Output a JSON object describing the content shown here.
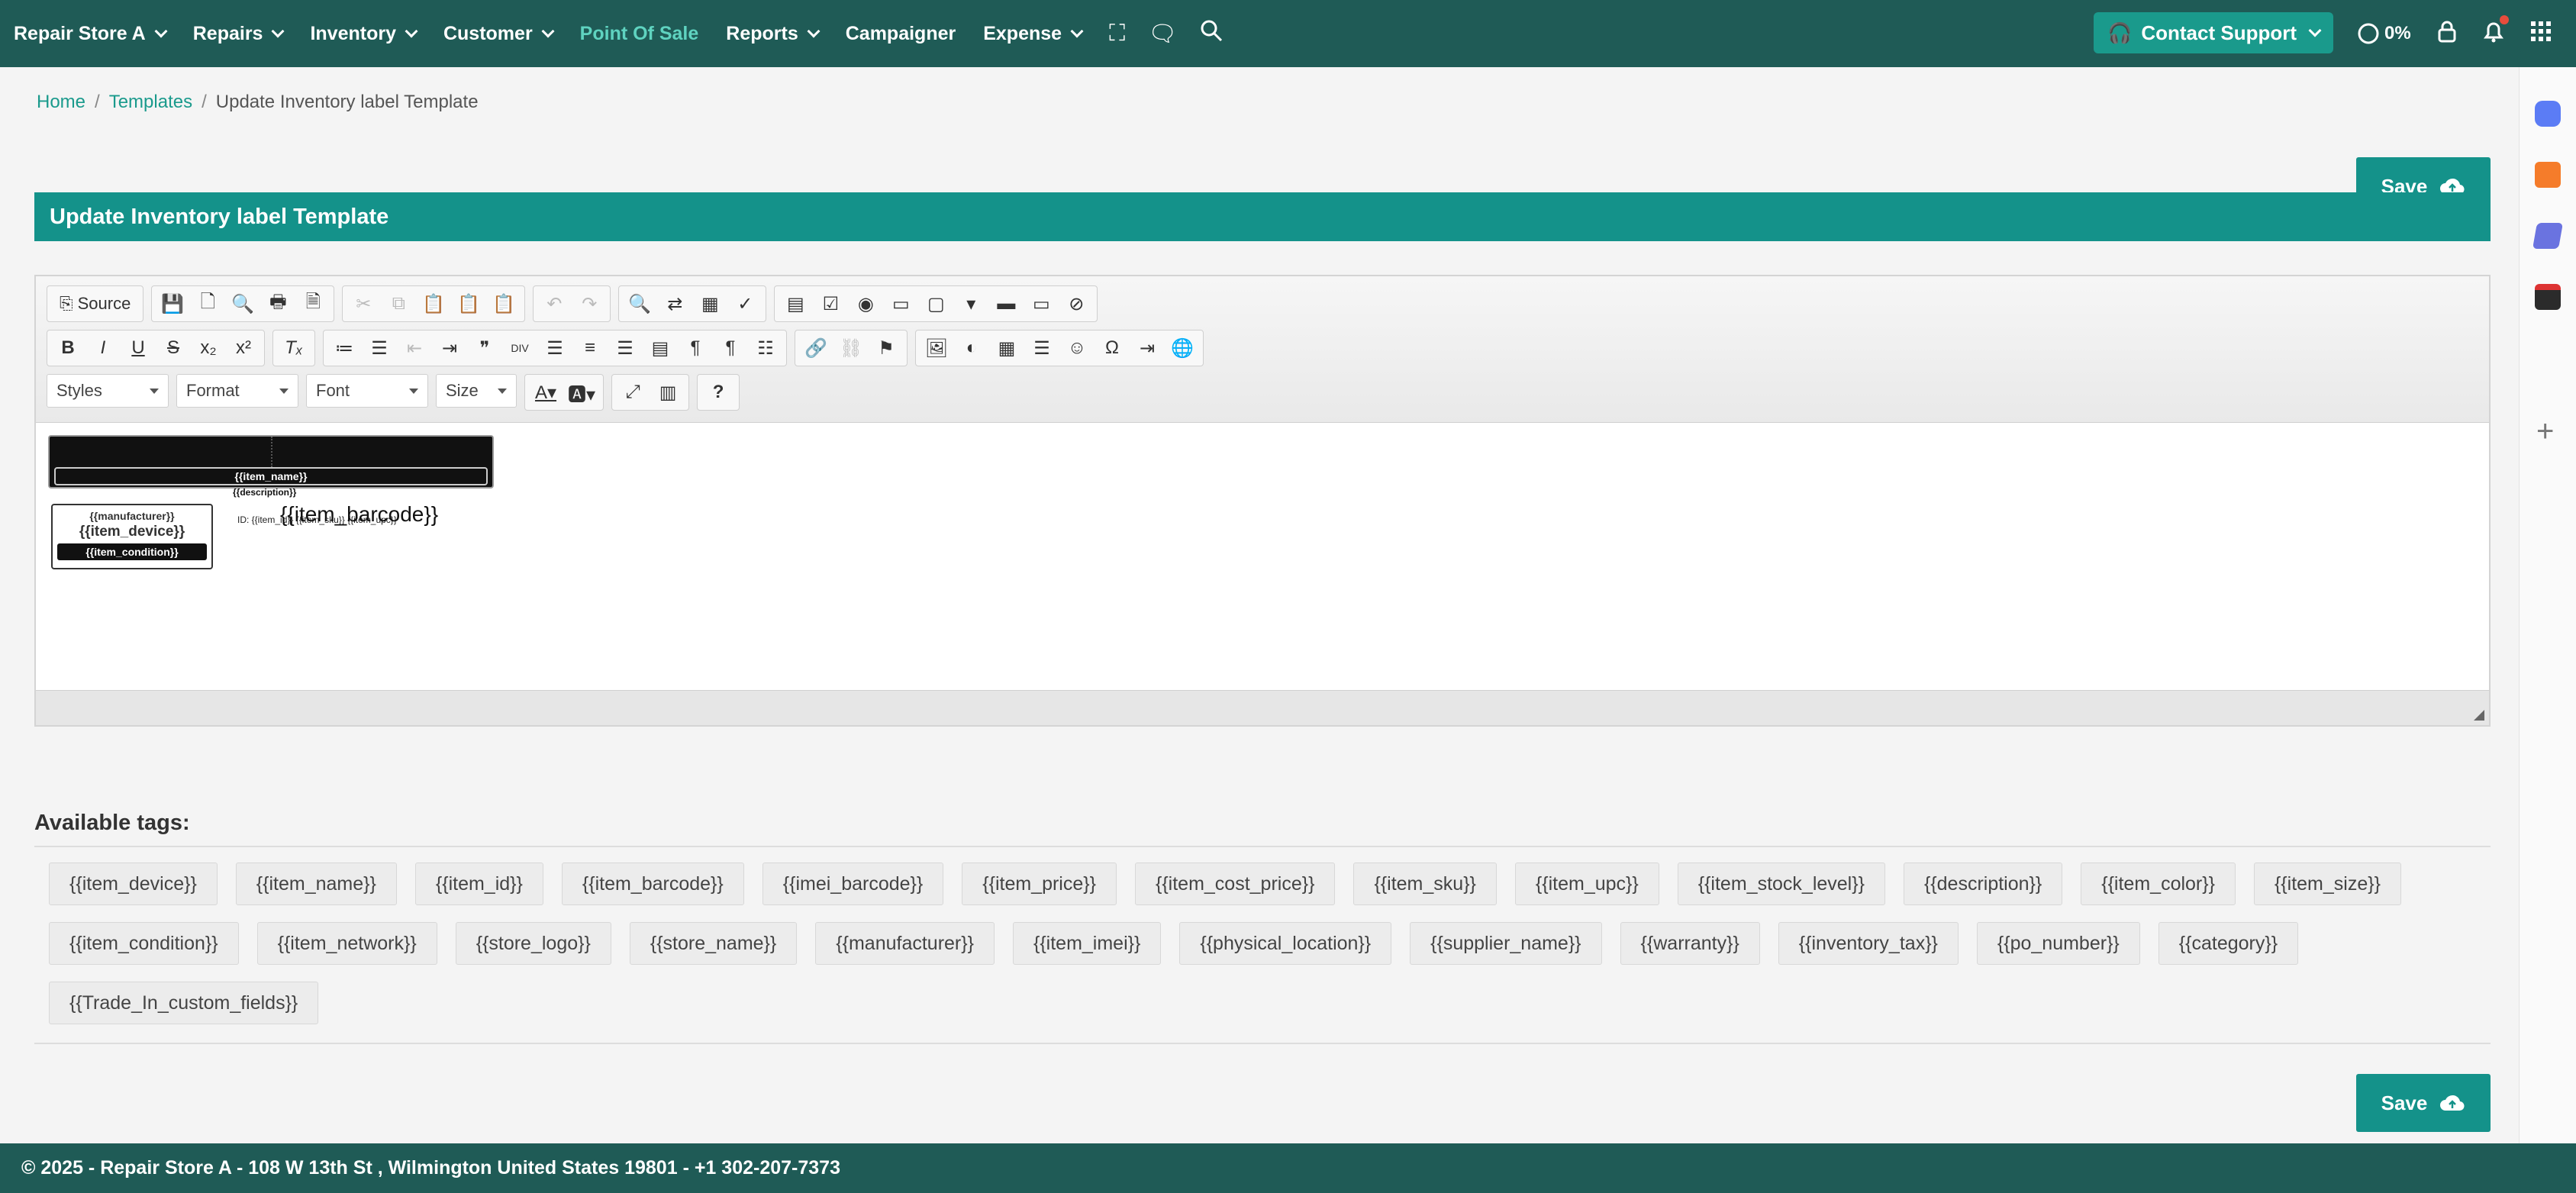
{
  "nav": {
    "store": "Repair Store A",
    "items": [
      {
        "label": "Repairs",
        "dropdown": true
      },
      {
        "label": "Inventory",
        "dropdown": true
      },
      {
        "label": "Customer",
        "dropdown": true
      },
      {
        "label": "Point Of Sale",
        "dropdown": false,
        "active": true
      },
      {
        "label": "Reports",
        "dropdown": true
      },
      {
        "label": "Campaigner",
        "dropdown": false
      },
      {
        "label": "Expense",
        "dropdown": true
      }
    ],
    "contact_label": "Contact Support",
    "progress": "0%"
  },
  "breadcrumb": {
    "home": "Home",
    "templates": "Templates",
    "sep": "/",
    "current": "Update Inventory label Template"
  },
  "save_label": "Save",
  "page_title": "Update Inventory label Template",
  "editor": {
    "source_label": "Source",
    "styles": "Styles",
    "format": "Format",
    "font": "Font",
    "size": "Size"
  },
  "label_preview": {
    "item_name": "{{item_name}}",
    "description": "{{description}}",
    "manufacturer": "{{manufacturer}}",
    "item_device": "{{item_device}}",
    "item_condition": "{{item_condition}}",
    "id_line": "ID: {{item_id}} {{item_sku}} {{item_upc}}",
    "barcode": "{{item_barcode}}"
  },
  "tags": {
    "title": "Available tags:",
    "list": [
      "{{item_device}}",
      "{{item_name}}",
      "{{item_id}}",
      "{{item_barcode}}",
      "{{imei_barcode}}",
      "{{item_price}}",
      "{{item_cost_price}}",
      "{{item_sku}}",
      "{{item_upc}}",
      "{{item_stock_level}}",
      "{{description}}",
      "{{item_color}}",
      "{{item_size}}",
      "{{item_condition}}",
      "{{item_network}}",
      "{{store_logo}}",
      "{{store_name}}",
      "{{manufacturer}}",
      "{{item_imei}}",
      "{{physical_location}}",
      "{{supplier_name}}",
      "{{warranty}}",
      "{{inventory_tax}}",
      "{{po_number}}",
      "{{category}}",
      "{{Trade_In_custom_fields}}"
    ]
  },
  "footer": "© 2025 - Repair Store A - 108 W 13th St , Wilmington United States 19801 - +1 302-207-7373"
}
